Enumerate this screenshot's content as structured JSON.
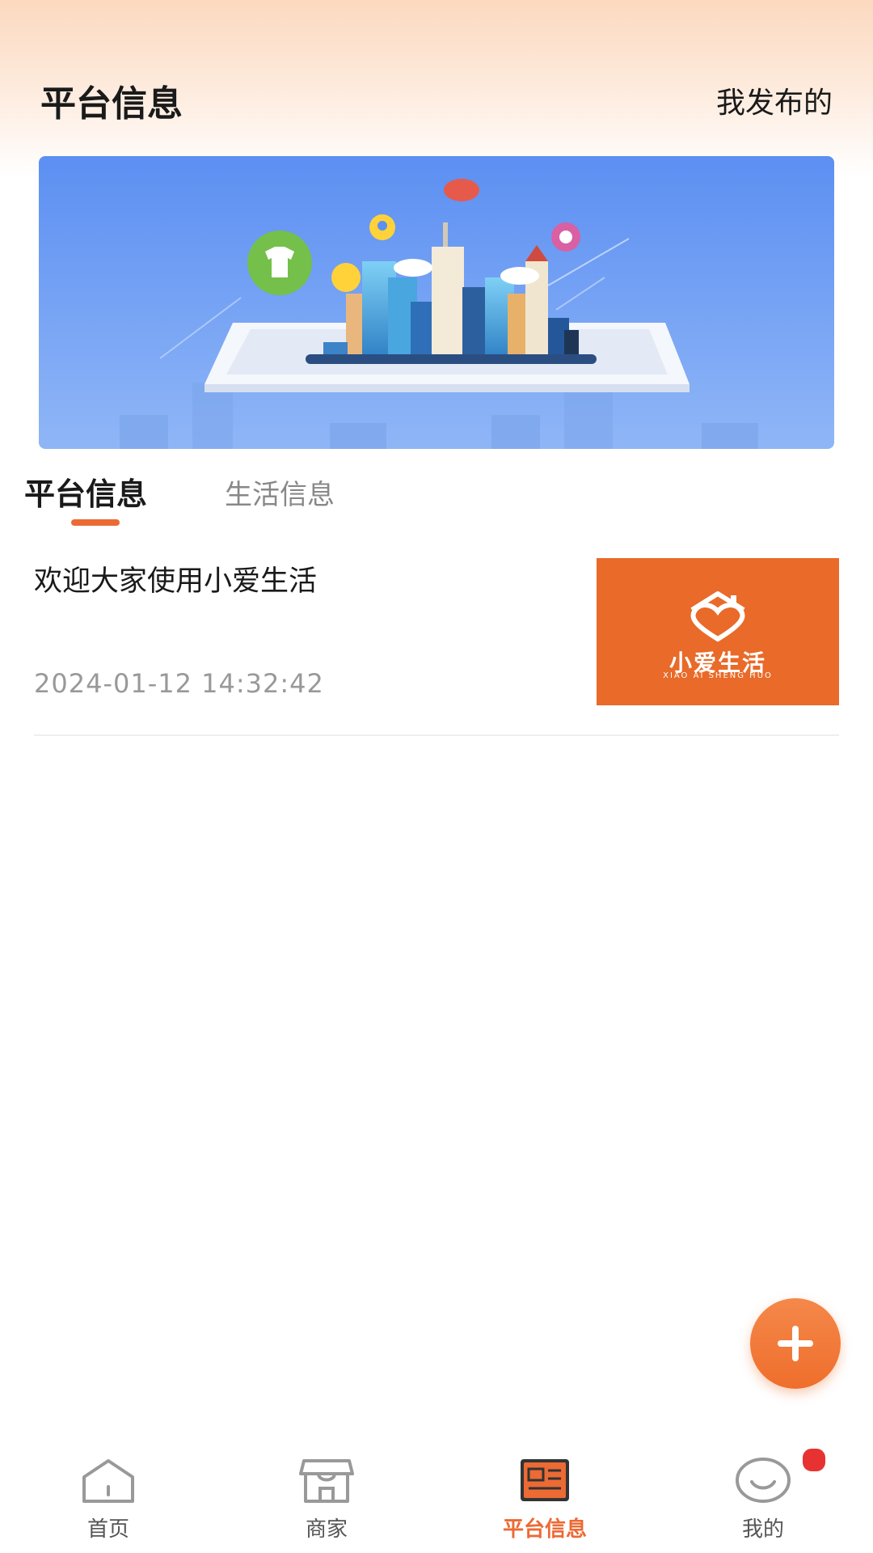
{
  "header": {
    "title": "平台信息",
    "action_label": "我发布的"
  },
  "banner": {
    "icons": [
      "shirt-icon",
      "location-pin-icon",
      "gamepad-icon",
      "film-icon",
      "sun-icon"
    ]
  },
  "tabs": [
    {
      "label": "平台信息",
      "active": true
    },
    {
      "label": "生活信息",
      "active": false
    }
  ],
  "news": [
    {
      "title": "欢迎大家使用小爱生活",
      "time": "2024-01-12 14:32:42",
      "thumb": {
        "brand": "小爱生活",
        "subtitle": "XIAO AI SHENG HUO",
        "background": "#e96a29"
      }
    }
  ],
  "fab": {
    "icon": "plus-icon"
  },
  "bottom_nav": [
    {
      "label": "首页",
      "icon": "home-icon",
      "active": false
    },
    {
      "label": "商家",
      "icon": "store-icon",
      "active": false
    },
    {
      "label": "平台信息",
      "icon": "news-icon",
      "active": true
    },
    {
      "label": "我的",
      "icon": "profile-icon",
      "active": false,
      "badge": true
    }
  ],
  "colors": {
    "accent": "#ec6a34",
    "inactive_text": "#888888",
    "badge": "#e83232"
  }
}
